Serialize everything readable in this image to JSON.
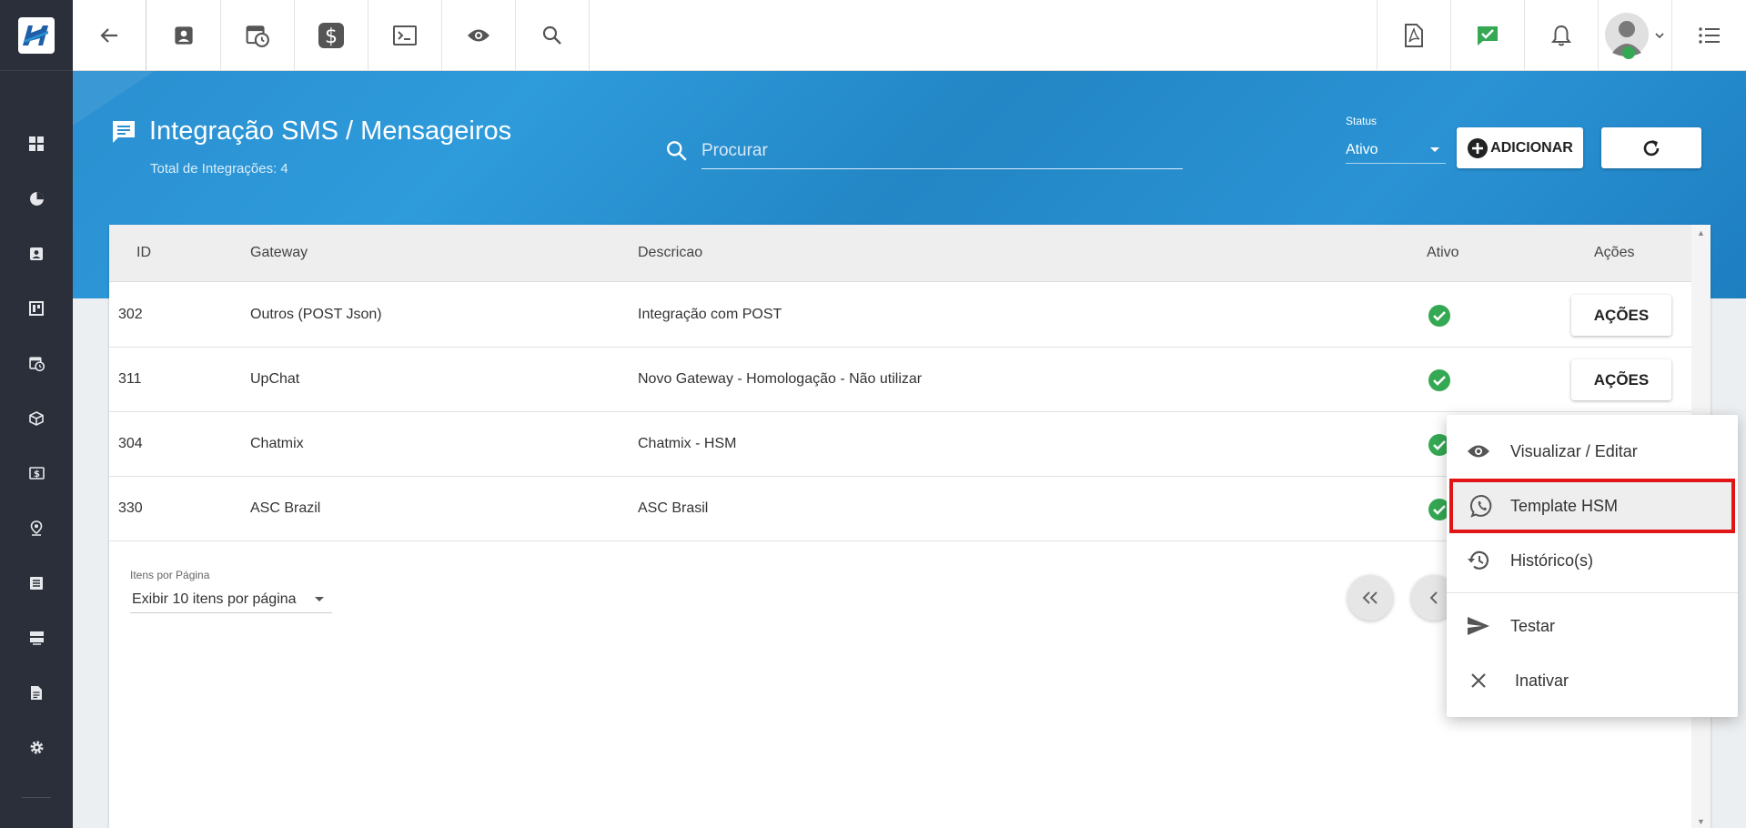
{
  "topbar": {
    "left_icons": [
      "back-arrow-icon",
      "contact-card-icon",
      "calendar-clock-icon",
      "dollar-icon",
      "terminal-icon",
      "eye-icon",
      "search-icon"
    ],
    "right_icons": [
      "pdf-icon",
      "chat-check-icon",
      "bell-icon",
      "user-avatar",
      "list-menu-icon"
    ]
  },
  "sidebar": {
    "icons": [
      "dashboard-icon",
      "pie-chart-icon",
      "contact-card-icon",
      "board-icon",
      "calendar-clock-icon",
      "box-icon",
      "money-icon",
      "location-pin-icon",
      "list-doc-icon",
      "server-icon",
      "document-icon",
      "gear-icon"
    ]
  },
  "header": {
    "title": "Integração SMS / Mensageiros",
    "subtitle": "Total de Integrações: 4",
    "search_placeholder": "Procurar",
    "status_label": "Status",
    "status_value": "Ativo",
    "add_label": "ADICIONAR"
  },
  "table": {
    "columns": [
      "ID",
      "Gateway",
      "Descricao",
      "Ativo",
      "Ações"
    ],
    "rows": [
      {
        "id": "302",
        "gateway": "Outros (POST Json)",
        "descricao": "Integração com POST",
        "ativo": true,
        "acoes": "AÇÕES"
      },
      {
        "id": "311",
        "gateway": "UpChat",
        "descricao": "Novo Gateway - Homologação - Não utilizar",
        "ativo": true,
        "acoes": "AÇÕES"
      },
      {
        "id": "304",
        "gateway": "Chatmix",
        "descricao": "Chatmix - HSM",
        "ativo": true
      },
      {
        "id": "330",
        "gateway": "ASC Brazil",
        "descricao": "ASC Brasil",
        "ativo": true
      }
    ]
  },
  "pagination": {
    "items_label": "Itens por Página",
    "items_value": "Exibir 10 itens por página"
  },
  "menu": {
    "items": [
      {
        "label": "Visualizar / Editar",
        "icon": "eye-icon"
      },
      {
        "label": "Template HSM",
        "icon": "whatsapp-icon"
      },
      {
        "label": "Histórico(s)",
        "icon": "history-icon"
      },
      {
        "label": "Testar",
        "icon": "send-icon"
      },
      {
        "label": "Inativar",
        "icon": "close-icon"
      }
    ]
  },
  "colors": {
    "sidebar": "#2a2f3a",
    "band": "#2a8fd0",
    "success": "#34a853",
    "highlight_border": "#e01616"
  }
}
